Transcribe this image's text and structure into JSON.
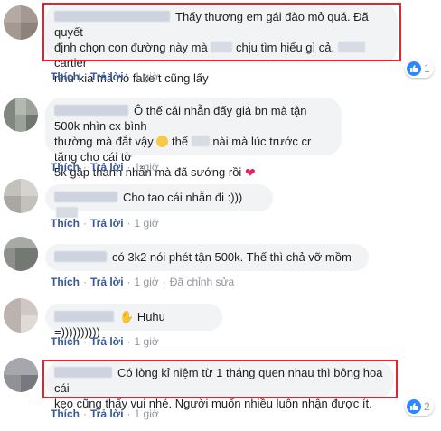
{
  "actions": {
    "like": "Thích",
    "reply": "Trả lời",
    "sep": "·",
    "edited": "Đã chỉnh sửa"
  },
  "comments": [
    {
      "line1": "Thấy thương em gái đào mỏ quá. Đã quyết",
      "line2a": "định chọn con đường này mà",
      "line2b": "chịu tìm hiểu gì cả.",
      "line2c": "cartier",
      "line3": "như kia mà nó fake t cũng lấy",
      "time": "1 giờ",
      "reaction_count": "1",
      "reaction_icon": "like-icon"
    },
    {
      "line1": "Ô thế cái nhẫn đấy giá bn mà tận 500k nhìn cx bình",
      "line2a": "thường mà đắt vậy",
      "line2b": "thế",
      "line2c": "nài mà lúc trước cr tặng cho cái tờ",
      "line3": "5k gập thành nhẫn mà đã sướng rồi",
      "emoji1": "worried-face-icon",
      "emoji2": "red-heart-icon",
      "time": "1 giờ"
    },
    {
      "text": "Cho tao cái nhẫn đi :)))",
      "time": "1 giờ"
    },
    {
      "text": "có 3k2 nói phét tận 500k. Thế thì chả vỡ mồm",
      "time": "1 giờ"
    },
    {
      "text": "Huhu =))))))))))",
      "emoji": "waving-hand-icon",
      "time": "1 giờ"
    },
    {
      "line1": "Có lòng kỉ niệm từ 1 tháng quen nhau thì bông hoa cái",
      "line2": "kẹo cũng thấy vui nhé. Người muốn nhiều luôn nhận được ít.",
      "time": "1 giờ",
      "reaction_count": "2",
      "reaction_icon": "like-icon"
    }
  ],
  "colors": {
    "bubble": "#f2f3f5",
    "link": "#385898",
    "highlight": "#e4232f",
    "like": "#2d88ff"
  }
}
